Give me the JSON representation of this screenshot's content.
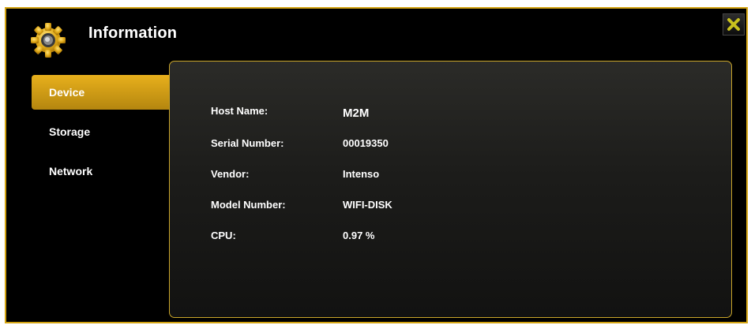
{
  "window": {
    "title": "Information"
  },
  "sidebar": {
    "items": [
      {
        "label": "Device",
        "active": true
      },
      {
        "label": "Storage",
        "active": false
      },
      {
        "label": "Network",
        "active": false
      }
    ]
  },
  "device_info": {
    "rows": [
      {
        "label": "Host Name:",
        "value": "M2M"
      },
      {
        "label": "Serial Number:",
        "value": "00019350"
      },
      {
        "label": "Vendor:",
        "value": "Intenso"
      },
      {
        "label": "Model Number:",
        "value": "WIFI-DISK"
      },
      {
        "label": "CPU:",
        "value": "0.97 %"
      }
    ]
  },
  "icons": {
    "header": "gear-icon",
    "close": "close-icon"
  },
  "colors": {
    "accent": "#d4a412",
    "background": "#000000",
    "close_x": "#c9c21e"
  }
}
